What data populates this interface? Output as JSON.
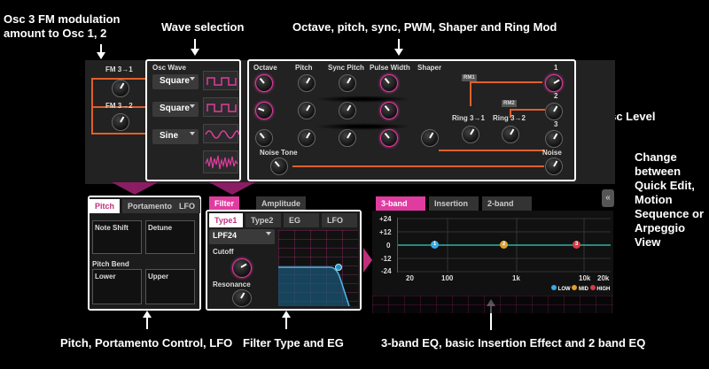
{
  "annotations": {
    "fm_amount": "Osc 3 FM modulation amount to Osc 1, 2",
    "wave_selection": "Wave selection",
    "octave_etc": "Octave, pitch, sync, PWM, Shaper and Ring Mod",
    "osc_level": "Osc Level",
    "change_view": "Change between Quick Edit, Motion Sequence or Arpeggio View",
    "pitch_portamento": "Pitch, Portamento Control, LFO",
    "filter_eg": "Filter Type and EG",
    "eq_insertion": "3-band EQ, basic Insertion Effect and 2 band EQ"
  },
  "fm": {
    "fm31": "FM 3→1",
    "fm32": "FM 3→2"
  },
  "osc_wave": {
    "title": "Osc Wave",
    "waves": [
      "Square",
      "Square",
      "Sine"
    ]
  },
  "columns": {
    "octave": "Octave",
    "pitch": "Pitch",
    "sync_pitch": "Sync Pitch",
    "pulse_width": "Pulse Width",
    "shaper": "Shaper"
  },
  "ring": {
    "r31": "Ring 3→1",
    "r32": "Ring 3→2",
    "rm1": "RM1",
    "rm2": "RM2"
  },
  "levels": {
    "l1": "1",
    "l2": "2",
    "l3": "3",
    "noise": "Noise"
  },
  "noise_tone": "Noise Tone",
  "pitch_panel": {
    "tabs": [
      "Pitch",
      "Portamento",
      "LFO"
    ],
    "note_shift": "Note Shift",
    "detune": "Detune",
    "pitch_bend": "Pitch Bend",
    "lower": "Lower",
    "upper": "Upper"
  },
  "filter_panel": {
    "top_tabs": [
      "Filter",
      "Amplitude"
    ],
    "tabs": [
      "Type1",
      "Type2",
      "EG",
      "LFO"
    ],
    "type": "LPF24",
    "cutoff": "Cutoff",
    "resonance": "Resonance"
  },
  "eq_panel": {
    "tabs": [
      "3-band",
      "Insertion",
      "2-band"
    ],
    "y_ticks": [
      "+24",
      "+12",
      "0",
      "-12",
      "-24"
    ],
    "x_ticks": [
      "20",
      "100",
      "1k",
      "10k",
      "20k"
    ],
    "bands": [
      "1",
      "2",
      "3"
    ],
    "legend": [
      "LOW",
      "MID",
      "HIGH"
    ]
  },
  "colors": {
    "accent": "#e03ca0",
    "osc_line": "#e0602a",
    "eq_line": "#2fb3a0"
  }
}
